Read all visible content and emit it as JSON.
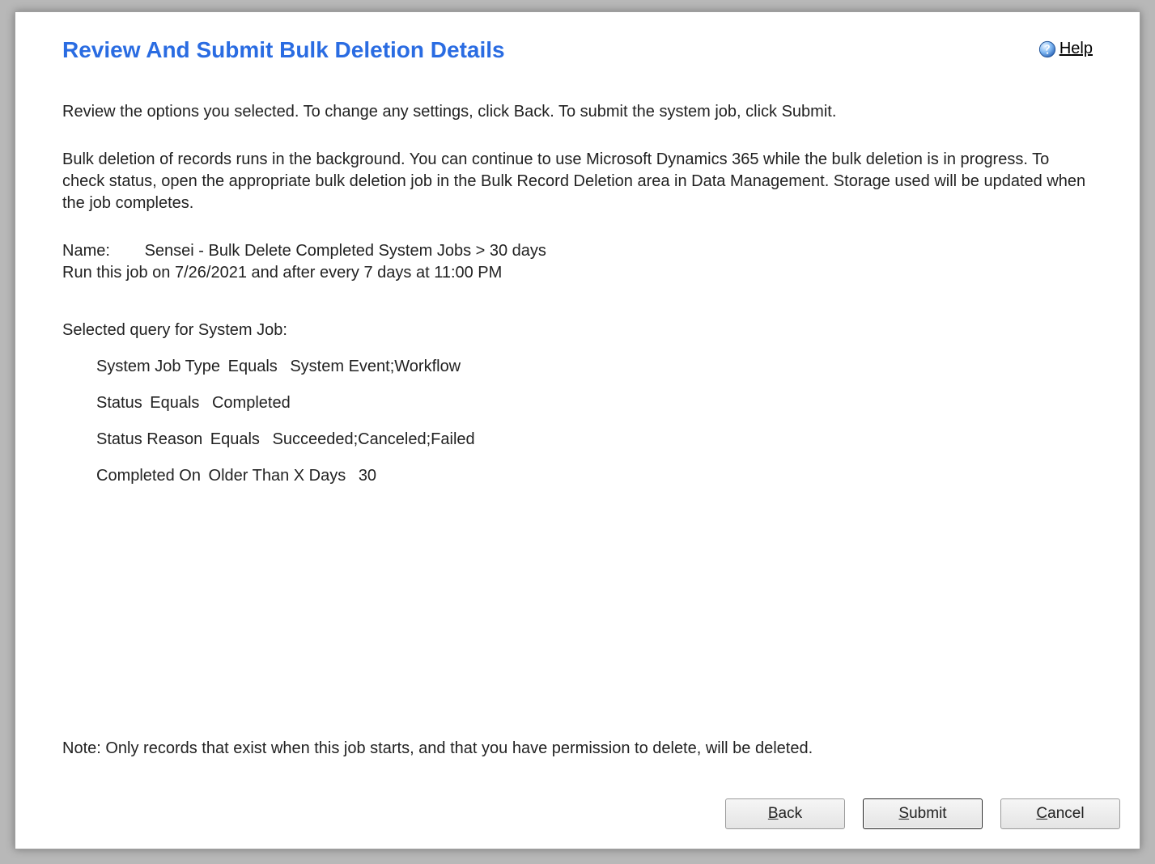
{
  "header": {
    "title": "Review And Submit Bulk Deletion Details",
    "help_label": "Help"
  },
  "body": {
    "intro1": "Review the options you selected. To change any settings, click Back. To submit the system job, click Submit.",
    "intro2": "Bulk deletion of records runs in the background. You can continue to use Microsoft Dynamics 365 while the bulk deletion is in progress. To check status, open the appropriate bulk deletion job in the Bulk Record Deletion area in Data Management. Storage used will be updated when the job completes.",
    "name_label": "Name:",
    "name_value": "Sensei - Bulk Delete Completed System Jobs > 30 days",
    "schedule_text": "Run this job on 7/26/2021 and after every 7 days at 11:00 PM",
    "query_heading": "Selected query for System Job:",
    "query_rows": [
      {
        "field": "System Job Type",
        "op": "Equals",
        "value": "System Event;Workflow"
      },
      {
        "field": "Status",
        "op": "Equals",
        "value": "Completed"
      },
      {
        "field": "Status Reason",
        "op": "Equals",
        "value": "Succeeded;Canceled;Failed"
      },
      {
        "field": "Completed On",
        "op": "Older Than X Days",
        "value": "30"
      }
    ],
    "note": "Note: Only records that exist when this job starts, and that you have permission to delete, will be deleted."
  },
  "footer": {
    "back_label": "Back",
    "submit_label": "Submit",
    "cancel_label": "Cancel"
  }
}
